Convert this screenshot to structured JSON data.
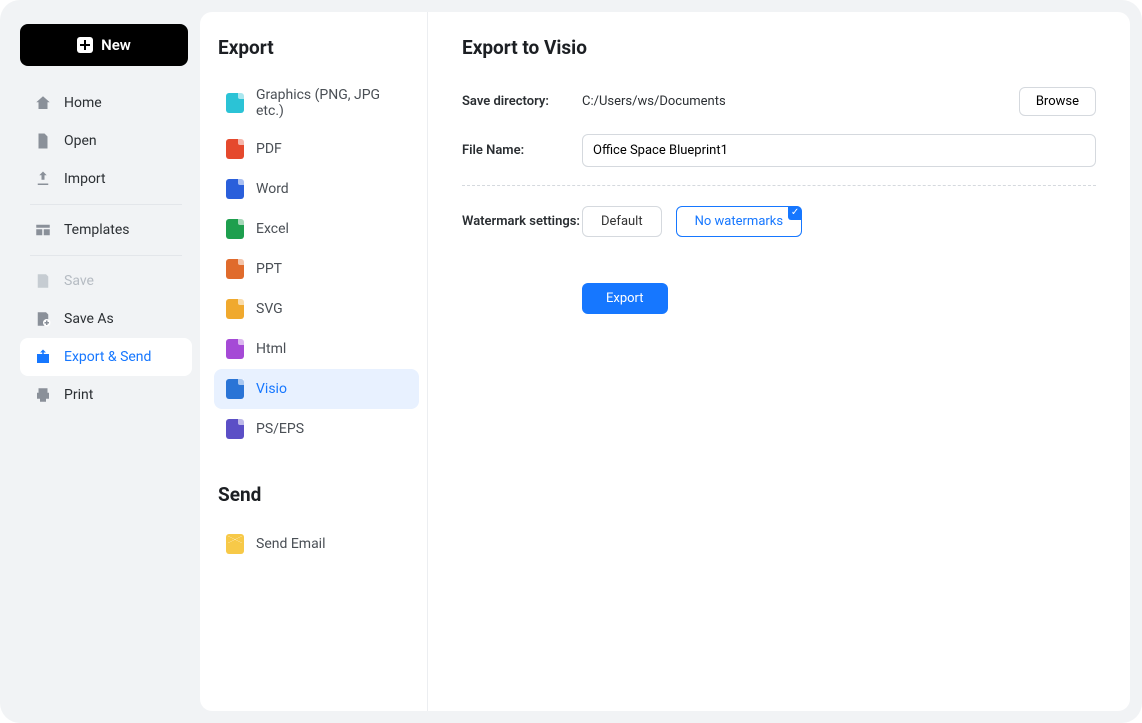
{
  "nav": {
    "new_label": "New",
    "items": [
      {
        "label": "Home"
      },
      {
        "label": "Open"
      },
      {
        "label": "Import"
      },
      {
        "label": "Templates"
      },
      {
        "label": "Save"
      },
      {
        "label": "Save As"
      },
      {
        "label": "Export & Send"
      },
      {
        "label": "Print"
      }
    ]
  },
  "export_panel": {
    "heading_export": "Export",
    "heading_send": "Send",
    "items": [
      {
        "label": "Graphics (PNG, JPG etc.)"
      },
      {
        "label": "PDF"
      },
      {
        "label": "Word"
      },
      {
        "label": "Excel"
      },
      {
        "label": "PPT"
      },
      {
        "label": "SVG"
      },
      {
        "label": "Html"
      },
      {
        "label": "Visio"
      },
      {
        "label": "PS/EPS"
      }
    ],
    "send_items": [
      {
        "label": "Send Email"
      }
    ]
  },
  "detail": {
    "title": "Export to Visio",
    "save_dir_label": "Save directory:",
    "save_dir_value": "C:/Users/ws/Documents",
    "browse_label": "Browse",
    "filename_label": "File Name:",
    "filename_value": "Office Space Blueprint1",
    "watermark_label": "Watermark settings:",
    "watermark_default": "Default",
    "watermark_none": "No watermarks",
    "export_button": "Export"
  }
}
